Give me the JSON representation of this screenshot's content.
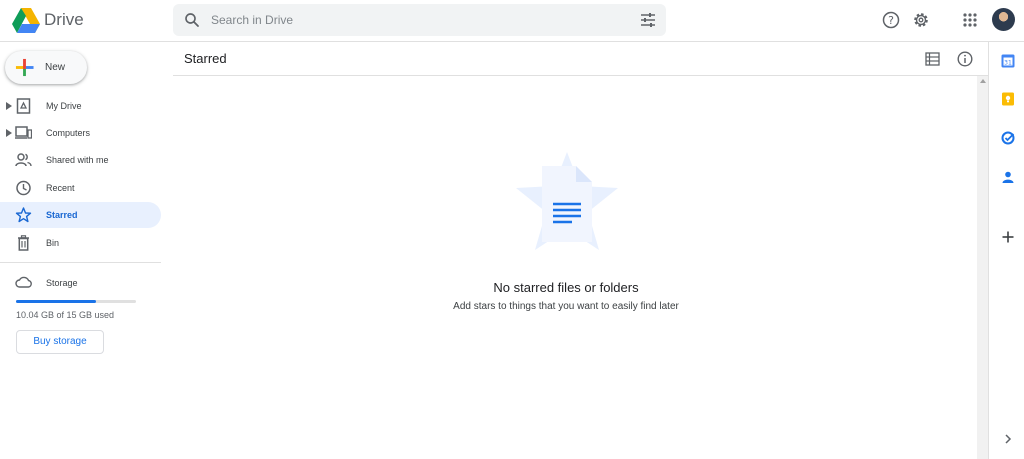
{
  "app": {
    "name": "Drive",
    "brand_colors": {
      "blue": "#4285f4",
      "green": "#0f9d58",
      "yellow": "#f4b400",
      "red": "#db4437"
    }
  },
  "header": {
    "search_placeholder": "Search in Drive",
    "icons": [
      "search-icon",
      "search-options-icon",
      "help-icon",
      "settings-icon",
      "apps-grid-icon",
      "account-avatar"
    ]
  },
  "sidebar": {
    "new_label": "New",
    "items": [
      {
        "label": "My Drive",
        "icon": "my-drive-icon",
        "expandable": true,
        "active": false
      },
      {
        "label": "Computers",
        "icon": "computers-icon",
        "expandable": true,
        "active": false
      },
      {
        "label": "Shared with me",
        "icon": "shared-icon",
        "expandable": false,
        "active": false
      },
      {
        "label": "Recent",
        "icon": "clock-icon",
        "expandable": false,
        "active": false
      },
      {
        "label": "Starred",
        "icon": "star-icon",
        "expandable": false,
        "active": true
      },
      {
        "label": "Bin",
        "icon": "bin-icon",
        "expandable": false,
        "active": false
      }
    ],
    "storage": {
      "label": "Storage",
      "used_text": "10.04 GB of 15 GB used",
      "used_fraction": 0.669,
      "buy_label": "Buy storage"
    }
  },
  "main": {
    "title": "Starred",
    "empty_title": "No starred files or folders",
    "empty_subtitle": "Add stars to things that you want to easily find later",
    "accent_color": "#1a73e8"
  },
  "right_rail": {
    "icons": [
      "calendar-icon",
      "keep-icon",
      "tasks-icon",
      "contacts-icon",
      "add-addon-icon",
      "expand-panel-icon"
    ]
  }
}
